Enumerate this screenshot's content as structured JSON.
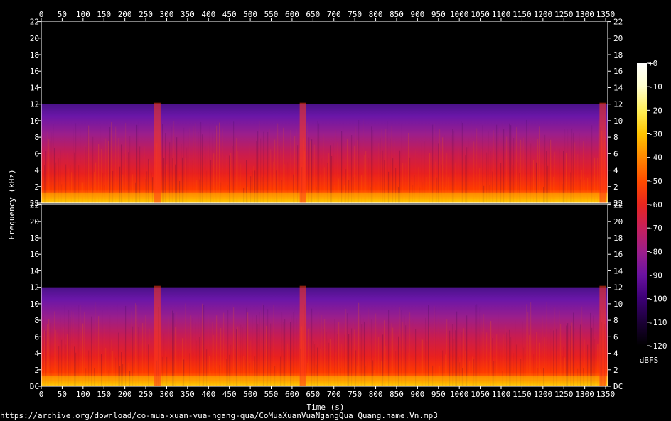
{
  "chart_data": {
    "type": "heatmap",
    "xlabel": "Time (s)",
    "ylabel": "Frequency (kHz)",
    "xlim": [
      0,
      1355
    ],
    "x_ticks": [
      0,
      50,
      100,
      150,
      200,
      250,
      300,
      350,
      400,
      450,
      500,
      550,
      600,
      650,
      700,
      750,
      800,
      850,
      900,
      950,
      1000,
      1050,
      1100,
      1150,
      1200,
      1250,
      1300,
      1350
    ],
    "channels": [
      {
        "ylim": [
          0,
          22.05
        ],
        "y_ticks": [
          {
            "value": 0,
            "label": "22"
          },
          {
            "value": 2,
            "label": "2"
          },
          {
            "value": 4,
            "label": "4"
          },
          {
            "value": 6,
            "label": "6"
          },
          {
            "value": 8,
            "label": "8"
          },
          {
            "value": 10,
            "label": "10"
          },
          {
            "value": 12,
            "label": "12"
          },
          {
            "value": 14,
            "label": "14"
          },
          {
            "value": 16,
            "label": "16"
          },
          {
            "value": 18,
            "label": "18"
          },
          {
            "value": 20,
            "label": "20"
          },
          {
            "value": 22,
            "label": "22"
          }
        ]
      },
      {
        "ylim": [
          0,
          22.05
        ],
        "y_ticks": [
          {
            "value": 0,
            "label": "DC"
          },
          {
            "value": 2,
            "label": "2"
          },
          {
            "value": 4,
            "label": "4"
          },
          {
            "value": 6,
            "label": "6"
          },
          {
            "value": 8,
            "label": "8"
          },
          {
            "value": 10,
            "label": "10"
          },
          {
            "value": 12,
            "label": "12"
          },
          {
            "value": 14,
            "label": "14"
          },
          {
            "value": 16,
            "label": "16"
          },
          {
            "value": 18,
            "label": "18"
          },
          {
            "value": 20,
            "label": "20"
          },
          {
            "value": 22,
            "label": "22"
          }
        ]
      }
    ],
    "content_cutoff_khz": 12,
    "colorbar": {
      "unit": "dBFS",
      "range": [
        -120,
        0
      ],
      "ticks": [
        {
          "value": 0,
          "label": "+0"
        },
        {
          "value": -10,
          "label": "-10"
        },
        {
          "value": -20,
          "label": "-20"
        },
        {
          "value": -30,
          "label": "-30"
        },
        {
          "value": -40,
          "label": "-40"
        },
        {
          "value": -50,
          "label": "-50"
        },
        {
          "value": -60,
          "label": "-60"
        },
        {
          "value": -70,
          "label": "-70"
        },
        {
          "value": -80,
          "label": "-80"
        },
        {
          "value": -90,
          "label": "-90"
        },
        {
          "value": -100,
          "label": "-100"
        },
        {
          "value": -110,
          "label": "-110"
        },
        {
          "value": -120,
          "label": "-120"
        }
      ],
      "colors": [
        "#000000",
        "#1a0033",
        "#3d0077",
        "#6a12a0",
        "#9a1e8c",
        "#c8205a",
        "#e8261f",
        "#ff4a00",
        "#ff8a00",
        "#ffc400",
        "#ffee55",
        "#ffffd0",
        "#ffffff"
      ]
    },
    "grid": false
  },
  "source_url": "https://archive.org/download/co-mua-xuan-vua-ngang-qua/CoMuaXuanVuaNgangQua_Quang.name.Vn.mp3"
}
